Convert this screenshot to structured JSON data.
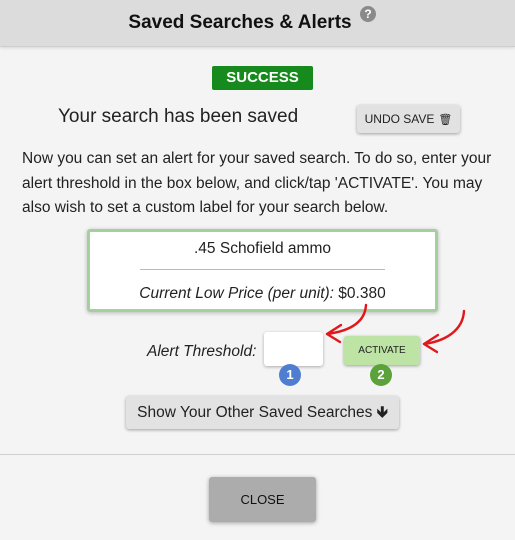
{
  "header": {
    "title": "Saved Searches & Alerts",
    "help_icon": "question-circle-icon",
    "help_glyph": "?"
  },
  "status": {
    "badge": "SUCCESS",
    "badge_color": "#168a1c",
    "message": "Your search has been saved"
  },
  "undo": {
    "label": "UNDO SAVE",
    "icon": "trash-icon",
    "glyph": "🗑"
  },
  "description": "Now you can set an alert for your saved search. To do so, enter your alert threshold in the box below, and click/tap 'ACTIVATE'. You may also wish to set a custom label for your search below.",
  "card": {
    "name": ".45 Schofield ammo",
    "price_label": "Current Low Price (per unit):",
    "price_value": "$0.380",
    "border_color": "#a3d19c"
  },
  "alert": {
    "threshold_label": "Alert Threshold:",
    "threshold_value": "",
    "activate_label": "ACTIVATE",
    "activate_color": "#bde3a5"
  },
  "steps": [
    "1",
    "2"
  ],
  "other_searches": {
    "label": "Show Your Other Saved Searches",
    "icon": "arrow-down-icon",
    "glyph": "🡻"
  },
  "close": {
    "label": "CLOSE"
  },
  "annotation_color": "#e0181b"
}
